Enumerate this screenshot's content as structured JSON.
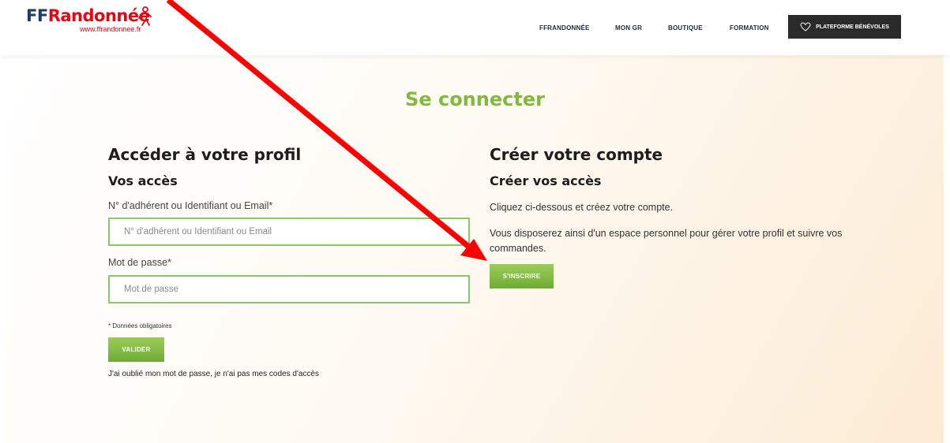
{
  "header": {
    "logo_ff": "FF",
    "logo_rando": "Randonnée",
    "logo_url": "www.ffrandonnee.fr",
    "nav": [
      "FFRANDONNÉE",
      "MON GR",
      "BOUTIQUE",
      "FORMATION"
    ],
    "cta_label": "PLATEFORME BÉNÉVOLES"
  },
  "page": {
    "title": "Se connecter"
  },
  "login": {
    "heading": "Accéder à votre profil",
    "subheading": "Vos accès",
    "id_label": "N° d'adhérent ou Identifiant ou Email*",
    "id_placeholder": "N° d'adhérent ou Identifiant ou Email",
    "id_value": "",
    "pw_label": "Mot de passe*",
    "pw_placeholder": "Mot de passe",
    "pw_value": "",
    "required_note": "* Données obligatoires",
    "submit_label": "VALIDER",
    "forgot_link": "J'ai oublié mon mot de passe, je n'ai pas mes codes d'accès"
  },
  "signup": {
    "heading": "Créer votre compte",
    "subheading": "Créer vos accès",
    "text1": "Cliquez ci-dessous et créez votre compte.",
    "text2": "Vous disposerez ainsi d'un espace personnel pour gérer votre profil et suivre vos commandes.",
    "button_label": "S'INSCRIRE"
  },
  "colors": {
    "accent_green": "#7fba3e",
    "brand_red": "#e30613",
    "annotation_arrow": "#ff0000"
  },
  "icons": {
    "logo_figure": "hiker-icon",
    "cta_icon": "heart-hands-icon"
  }
}
